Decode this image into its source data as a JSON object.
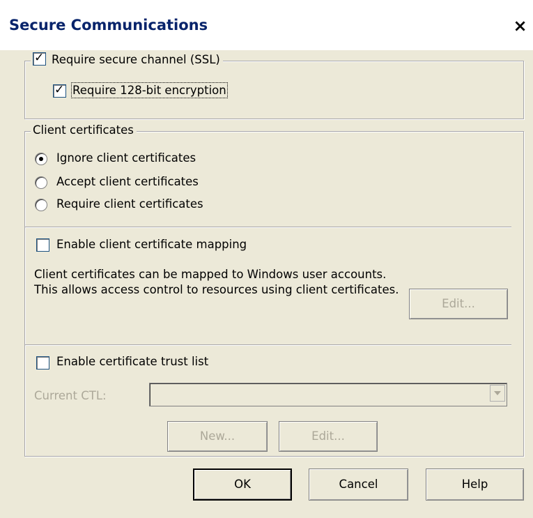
{
  "dialog": {
    "title": "Secure Communications",
    "close_glyph": "×"
  },
  "ssl": {
    "require_secure_channel": {
      "label": "Require secure channel (SSL)",
      "checked": true
    },
    "require_128bit": {
      "label": "Require 128-bit encryption",
      "checked": true
    }
  },
  "client_certificates": {
    "legend": "Client certificates",
    "options": [
      {
        "label": "Ignore client certificates",
        "selected": true
      },
      {
        "label": "Accept client certificates",
        "selected": false
      },
      {
        "label": "Require client certificates",
        "selected": false
      }
    ],
    "mapping": {
      "label": "Enable client certificate mapping",
      "checked": false,
      "description": "Client certificates can be mapped to Windows user accounts.  This allows access control to resources using client certificates.",
      "edit_label": "Edit..."
    },
    "ctl": {
      "enable_label": "Enable certificate trust list",
      "checked": false,
      "current_ctl_label": "Current CTL:",
      "current_ctl_value": "",
      "new_label": "New...",
      "edit_label": "Edit..."
    }
  },
  "buttons": {
    "ok": "OK",
    "cancel": "Cancel",
    "help": "Help"
  },
  "colors": {
    "title_text": "#08246b",
    "dialog_bg": "#ece9d8",
    "disabled_text": "#aca899"
  }
}
